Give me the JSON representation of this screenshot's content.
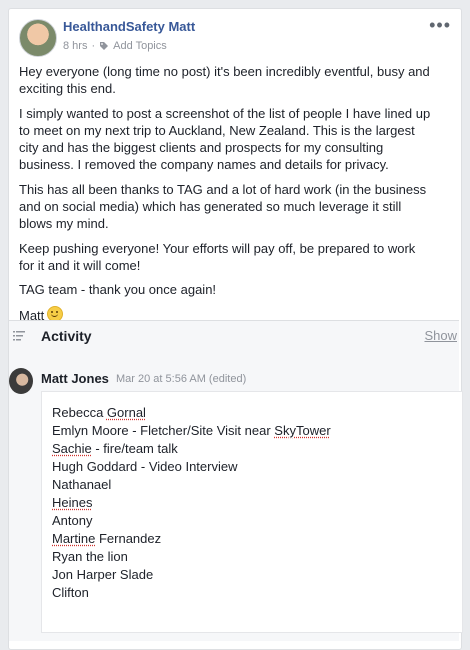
{
  "post": {
    "author": "HealthandSafety Matt",
    "time": "8 hrs",
    "separator": "·",
    "add_topics": "Add Topics",
    "more": "•••",
    "paragraphs": [
      "Hey everyone (long time no post) it's been incredibly eventful, busy and exciting this end.",
      "I simply wanted to post a screenshot of the list of people I have lined up to meet on my next trip to Auckland, New Zealand. This is the largest city and has the biggest clients and prospects for my consulting business. I removed the company names and details for privacy.",
      "This has all been thanks to TAG and a lot of hard work (in the business and on social media) which has generated so much leverage it still blows my mind.",
      "Keep pushing everyone! Your efforts will pay off, be prepared to work for it and it will come!",
      "TAG team - thank you once again!"
    ],
    "signoff": "Matt",
    "icons": {
      "tag": "tag-icon",
      "more": "more-dots-icon",
      "emoji": "smiley-emoji-icon"
    }
  },
  "activity": {
    "title": "Activity",
    "show": "Show",
    "icon": "list-icon"
  },
  "comment": {
    "name": "Matt Jones",
    "time": "Mar 20 at 5:56 AM (edited)",
    "lines": {
      "l1a": "Rebecca ",
      "l1b": "Gornal",
      "l2a": "Emlyn Moore - Fletcher/Site Visit near ",
      "l2b": "SkyTower",
      "l3a": "Sachie",
      "l3b": " - fire/team talk",
      "l4": "Hugh Goddard - Video Interview",
      "l5": "Nathanael",
      "l6": "Heines",
      "l7": "Antony",
      "l8a": "Martine",
      "l8b": " Fernandez",
      "l9": "Ryan the lion",
      "l10": "Jon Harper Slade",
      "l11": "Clifton"
    }
  },
  "colors": {
    "link": "#385898",
    "meta": "#90949c",
    "text": "#1d2129",
    "bg": "#e9ebee"
  }
}
